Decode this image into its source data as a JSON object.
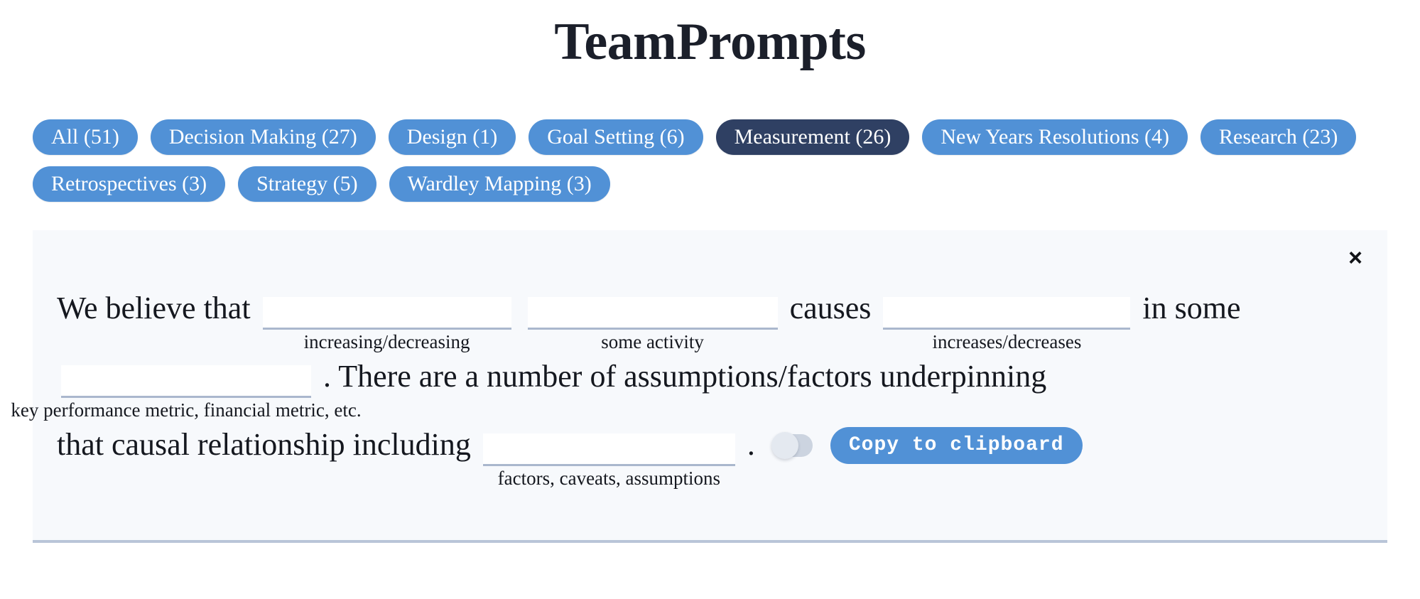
{
  "header": {
    "title": "TeamPrompts"
  },
  "filters": {
    "active_index": 4,
    "items": [
      {
        "label": "All (51)",
        "name": "All",
        "count": 51,
        "active": false
      },
      {
        "label": "Decision Making (27)",
        "name": "Decision Making",
        "count": 27,
        "active": false
      },
      {
        "label": "Design (1)",
        "name": "Design",
        "count": 1,
        "active": false
      },
      {
        "label": "Goal Setting (6)",
        "name": "Goal Setting",
        "count": 6,
        "active": false
      },
      {
        "label": "Measurement (26)",
        "name": "Measurement",
        "count": 26,
        "active": true
      },
      {
        "label": "New Years Resolutions (4)",
        "name": "New Years Resolutions",
        "count": 4,
        "active": false
      },
      {
        "label": "Research (23)",
        "name": "Research",
        "count": 23,
        "active": false
      },
      {
        "label": "Retrospectives (3)",
        "name": "Retrospectives",
        "count": 3,
        "active": false
      },
      {
        "label": "Strategy (5)",
        "name": "Strategy",
        "count": 5,
        "active": false
      },
      {
        "label": "Wardley Mapping (3)",
        "name": "Wardley Mapping",
        "count": 3,
        "active": false
      }
    ]
  },
  "card": {
    "close_icon": "×",
    "prompt": {
      "text_1": "We believe that",
      "text_2": "causes",
      "text_3": "in",
      "text_4": "some",
      "text_5": ". There are a number of assumptions/factors underpinning",
      "text_6": "that causal relationship including",
      "text_7": "."
    },
    "blanks": [
      {
        "value": "",
        "placeholder": "",
        "caption": "increasing/decreasing"
      },
      {
        "value": "",
        "placeholder": "",
        "caption": "some activity"
      },
      {
        "value": "",
        "placeholder": "",
        "caption": "increases/decreases"
      },
      {
        "value": "",
        "placeholder": "",
        "caption": "key performance metric, financial metric, etc."
      },
      {
        "value": "",
        "placeholder": "",
        "caption": "factors, caveats, assumptions"
      }
    ],
    "toggle": {
      "name": "expand-toggle",
      "state": "off"
    },
    "copy_button": {
      "label": "Copy to clipboard"
    }
  },
  "colors": {
    "pill": "#5191d6",
    "pill_active": "#2f4063",
    "card_bg": "#f7f9fc",
    "card_border": "#b9c5d8",
    "input_underline": "#aab7cd",
    "toggle_track": "#ccd4e0",
    "toggle_knob": "#e4e9f0",
    "text": "#15181f",
    "page_bg": "#ffffff"
  }
}
